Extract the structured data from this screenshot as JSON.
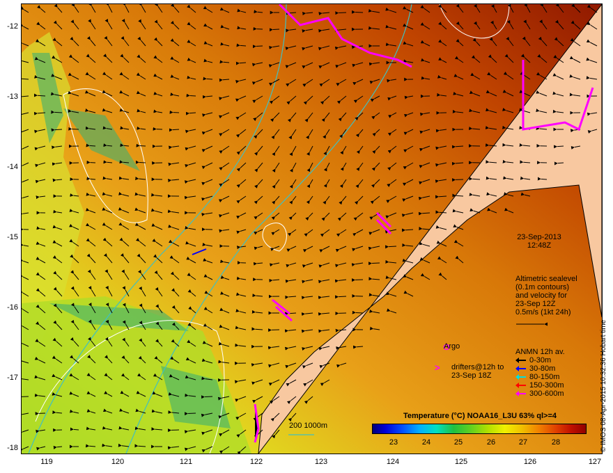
{
  "map": {
    "y_ticks": [
      "-12",
      "-13",
      "-14",
      "-15",
      "-16",
      "-17",
      "-18"
    ],
    "x_ticks": [
      "119",
      "120",
      "121",
      "122",
      "123",
      "124",
      "125",
      "126",
      "127"
    ],
    "colors": {
      "land": "#f8c8a0",
      "contour": "#ffffff",
      "bathymetry": "#40c0c0",
      "drifter": "#ff00ff"
    }
  },
  "annotations": {
    "date": "23-Sep-2013",
    "time": "12:48Z",
    "altimetry_lines": [
      "Altimetric sealevel",
      "(0.1m contours)",
      "and velocity for",
      "23-Sep 12Z",
      "0.5m/s (1kt 24h)"
    ]
  },
  "legend": {
    "argo_label": "Argo",
    "drifters_lines": [
      "drifters@12h to",
      "23-Sep 18Z"
    ],
    "anmn_title": "ANMN 12h av.",
    "anmn_depths": [
      {
        "label": "0-30m",
        "color": "#000000"
      },
      {
        "label": "30-80m",
        "color": "#0000ff"
      },
      {
        "label": "80-150m",
        "color": "#00e0e0"
      },
      {
        "label": "150-300m",
        "color": "#ff0000"
      },
      {
        "label": "300-600m",
        "color": "#ff00ff"
      }
    ],
    "depth_contours": "200  1000m"
  },
  "colorbar": {
    "title": "Temperature (°C) NOAA16_L3U 63% ql>=4",
    "ticks": [
      "23",
      "24",
      "25",
      "26",
      "27",
      "28"
    ]
  },
  "credit": "© IMOS 08-Apr-2015 10:32:36 Hobart time"
}
